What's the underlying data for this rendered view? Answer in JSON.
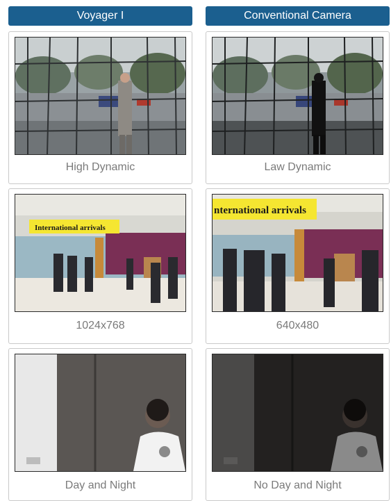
{
  "columns": [
    {
      "title": "Voyager I",
      "rows": [
        {
          "caption": "High Dynamic"
        },
        {
          "caption": "1024x768",
          "sign_text": "International arrivals"
        },
        {
          "caption": "Day and Night"
        }
      ]
    },
    {
      "title": "Conventional Camera",
      "rows": [
        {
          "caption": "Law Dynamic"
        },
        {
          "caption": "640x480",
          "sign_text": "nternational arrivals"
        },
        {
          "caption": "No Day and Night"
        }
      ]
    }
  ],
  "colors": {
    "header_bg": "#1b5f8f",
    "header_text": "#ffffff",
    "card_border": "#c9c9c9",
    "caption_text": "#7a7a7a",
    "sign_bg": "#f5e631"
  }
}
